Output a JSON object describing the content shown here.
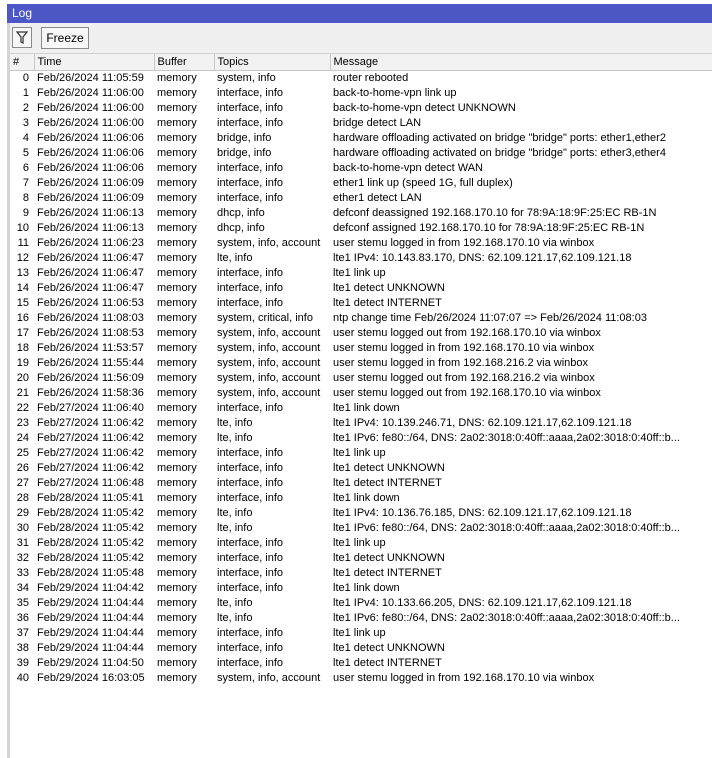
{
  "window": {
    "title": "Log"
  },
  "toolbar": {
    "filter_icon": "filter-icon",
    "freeze_label": "Freeze"
  },
  "table": {
    "columns": [
      "#",
      "Time",
      "Buffer",
      "Topics",
      "Message"
    ],
    "rows": [
      [
        "0",
        "Feb/26/2024 11:05:59",
        "memory",
        "system, info",
        "router rebooted"
      ],
      [
        "1",
        "Feb/26/2024 11:06:00",
        "memory",
        "interface, info",
        "back-to-home-vpn link up"
      ],
      [
        "2",
        "Feb/26/2024 11:06:00",
        "memory",
        "interface, info",
        "back-to-home-vpn detect UNKNOWN"
      ],
      [
        "3",
        "Feb/26/2024 11:06:00",
        "memory",
        "interface, info",
        "bridge detect LAN"
      ],
      [
        "4",
        "Feb/26/2024 11:06:06",
        "memory",
        "bridge, info",
        "hardware offloading activated on bridge \"bridge\" ports: ether1,ether2"
      ],
      [
        "5",
        "Feb/26/2024 11:06:06",
        "memory",
        "bridge, info",
        "hardware offloading activated on bridge \"bridge\" ports: ether3,ether4"
      ],
      [
        "6",
        "Feb/26/2024 11:06:06",
        "memory",
        "interface, info",
        "back-to-home-vpn detect WAN"
      ],
      [
        "7",
        "Feb/26/2024 11:06:09",
        "memory",
        "interface, info",
        "ether1 link up (speed 1G, full duplex)"
      ],
      [
        "8",
        "Feb/26/2024 11:06:09",
        "memory",
        "interface, info",
        "ether1 detect LAN"
      ],
      [
        "9",
        "Feb/26/2024 11:06:13",
        "memory",
        "dhcp, info",
        "defconf deassigned 192.168.170.10 for 78:9A:18:9F:25:EC RB-1N"
      ],
      [
        "10",
        "Feb/26/2024 11:06:13",
        "memory",
        "dhcp, info",
        "defconf assigned 192.168.170.10 for 78:9A:18:9F:25:EC RB-1N"
      ],
      [
        "11",
        "Feb/26/2024 11:06:23",
        "memory",
        "system, info, account",
        "user stemu logged in from 192.168.170.10 via winbox"
      ],
      [
        "12",
        "Feb/26/2024 11:06:47",
        "memory",
        "lte, info",
        "lte1 IPv4: 10.143.83.170, DNS: 62.109.121.17,62.109.121.18"
      ],
      [
        "13",
        "Feb/26/2024 11:06:47",
        "memory",
        "interface, info",
        "lte1 link up"
      ],
      [
        "14",
        "Feb/26/2024 11:06:47",
        "memory",
        "interface, info",
        "lte1 detect UNKNOWN"
      ],
      [
        "15",
        "Feb/26/2024 11:06:53",
        "memory",
        "interface, info",
        "lte1 detect INTERNET"
      ],
      [
        "16",
        "Feb/26/2024 11:08:03",
        "memory",
        "system, critical, info",
        "ntp change time Feb/26/2024 11:07:07 => Feb/26/2024 11:08:03"
      ],
      [
        "17",
        "Feb/26/2024 11:08:53",
        "memory",
        "system, info, account",
        "user stemu logged out from 192.168.170.10 via winbox"
      ],
      [
        "18",
        "Feb/26/2024 11:53:57",
        "memory",
        "system, info, account",
        "user stemu logged in from 192.168.170.10 via winbox"
      ],
      [
        "19",
        "Feb/26/2024 11:55:44",
        "memory",
        "system, info, account",
        "user stemu logged in from 192.168.216.2 via winbox"
      ],
      [
        "20",
        "Feb/26/2024 11:56:09",
        "memory",
        "system, info, account",
        "user stemu logged out from 192.168.216.2 via winbox"
      ],
      [
        "21",
        "Feb/26/2024 11:58:36",
        "memory",
        "system, info, account",
        "user stemu logged out from 192.168.170.10 via winbox"
      ],
      [
        "22",
        "Feb/27/2024 11:06:40",
        "memory",
        "interface, info",
        "lte1 link down"
      ],
      [
        "23",
        "Feb/27/2024 11:06:42",
        "memory",
        "lte, info",
        "lte1 IPv4: 10.139.246.71, DNS: 62.109.121.17,62.109.121.18"
      ],
      [
        "24",
        "Feb/27/2024 11:06:42",
        "memory",
        "lte, info",
        "lte1 IPv6: fe80::/64, DNS: 2a02:3018:0:40ff::aaaa,2a02:3018:0:40ff::b..."
      ],
      [
        "25",
        "Feb/27/2024 11:06:42",
        "memory",
        "interface, info",
        "lte1 link up"
      ],
      [
        "26",
        "Feb/27/2024 11:06:42",
        "memory",
        "interface, info",
        "lte1 detect UNKNOWN"
      ],
      [
        "27",
        "Feb/27/2024 11:06:48",
        "memory",
        "interface, info",
        "lte1 detect INTERNET"
      ],
      [
        "28",
        "Feb/28/2024 11:05:41",
        "memory",
        "interface, info",
        "lte1 link down"
      ],
      [
        "29",
        "Feb/28/2024 11:05:42",
        "memory",
        "lte, info",
        "lte1 IPv4: 10.136.76.185, DNS: 62.109.121.17,62.109.121.18"
      ],
      [
        "30",
        "Feb/28/2024 11:05:42",
        "memory",
        "lte, info",
        "lte1 IPv6: fe80::/64, DNS: 2a02:3018:0:40ff::aaaa,2a02:3018:0:40ff::b..."
      ],
      [
        "31",
        "Feb/28/2024 11:05:42",
        "memory",
        "interface, info",
        "lte1 link up"
      ],
      [
        "32",
        "Feb/28/2024 11:05:42",
        "memory",
        "interface, info",
        "lte1 detect UNKNOWN"
      ],
      [
        "33",
        "Feb/28/2024 11:05:48",
        "memory",
        "interface, info",
        "lte1 detect INTERNET"
      ],
      [
        "34",
        "Feb/29/2024 11:04:42",
        "memory",
        "interface, info",
        "lte1 link down"
      ],
      [
        "35",
        "Feb/29/2024 11:04:44",
        "memory",
        "lte, info",
        "lte1 IPv4: 10.133.66.205, DNS: 62.109.121.17,62.109.121.18"
      ],
      [
        "36",
        "Feb/29/2024 11:04:44",
        "memory",
        "lte, info",
        "lte1 IPv6: fe80::/64, DNS: 2a02:3018:0:40ff::aaaa,2a02:3018:0:40ff::b..."
      ],
      [
        "37",
        "Feb/29/2024 11:04:44",
        "memory",
        "interface, info",
        "lte1 link up"
      ],
      [
        "38",
        "Feb/29/2024 11:04:44",
        "memory",
        "interface, info",
        "lte1 detect UNKNOWN"
      ],
      [
        "39",
        "Feb/29/2024 11:04:50",
        "memory",
        "interface, info",
        "lte1 detect INTERNET"
      ],
      [
        "40",
        "Feb/29/2024 16:03:05",
        "memory",
        "system, info, account",
        "user stemu logged in from 192.168.170.10 via winbox"
      ]
    ]
  },
  "colors": {
    "titlebar": "#4d58c6",
    "toolbar": "#f0f0f0",
    "header": "#f2f2f2"
  }
}
